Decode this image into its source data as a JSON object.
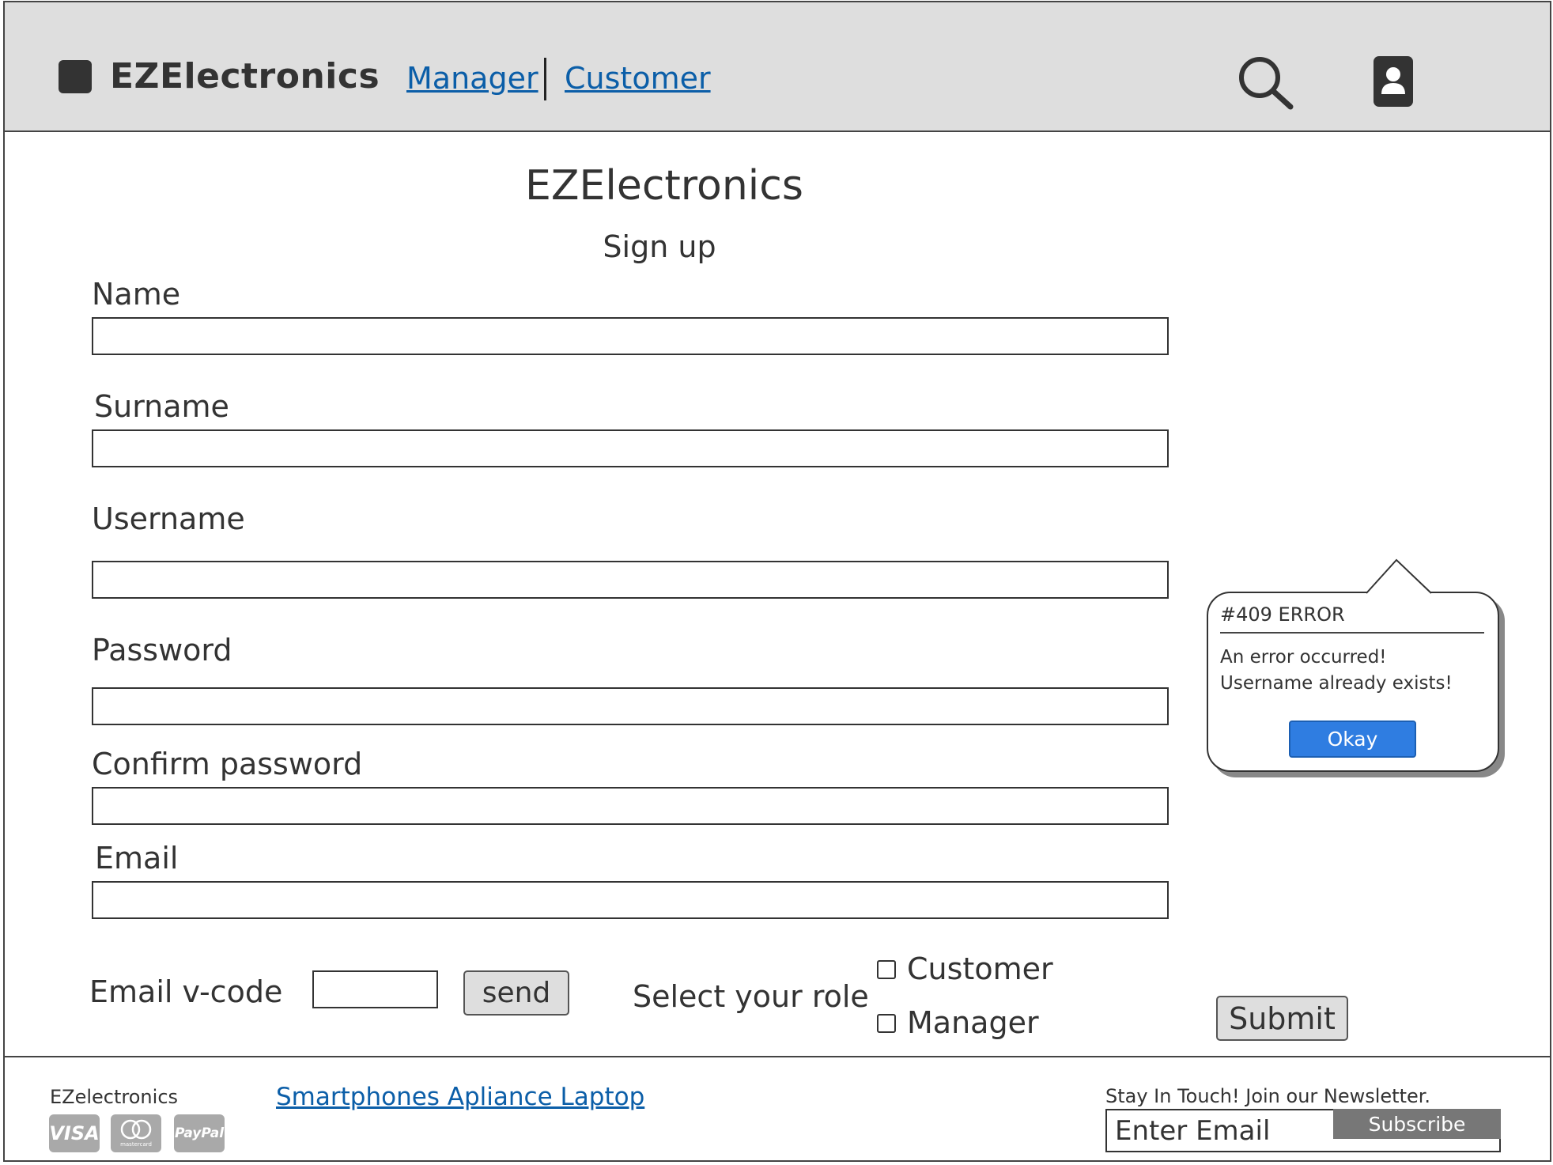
{
  "colors": {
    "header_bg": "#dedede",
    "link": "#0b5ea8",
    "text": "#333333",
    "okay_button": "#2f7de1",
    "subscribe_button": "#777777",
    "payment_badge": "#a9a9a9"
  },
  "header": {
    "logo_icon": "square-logo-icon",
    "brand": "EZElectronics",
    "nav": [
      "Manager",
      "Customer"
    ],
    "search_icon": "search-icon",
    "user_icon": "user-profile-icon"
  },
  "form": {
    "title": "EZElectronics",
    "subtitle": "Sign up",
    "fields": {
      "name_label": "Name",
      "name_value": "",
      "surname_label": "Surname",
      "surname_value": "",
      "username_label": "Username",
      "username_value": "",
      "password_label": "Password",
      "password_value": "",
      "confirm_password_label": "Confirm password",
      "confirm_password_value": "",
      "email_label": "Email",
      "email_value": ""
    },
    "email_vcode_label": "Email v-code",
    "email_vcode_value": "",
    "send_label": "send",
    "role_label": "Select your role",
    "roles": [
      {
        "label": "Customer",
        "checked": false
      },
      {
        "label": "Manager",
        "checked": false
      }
    ],
    "submit_label": "Submit"
  },
  "error_popup": {
    "title": "#409 ERROR",
    "line1": "An error occurred!",
    "line2": "Username already exists!",
    "okay_label": "Okay"
  },
  "footer": {
    "brand": "EZelectronics",
    "links": "Smartphones Apliance Laptop",
    "payment_methods": [
      "VISA",
      "mastercard",
      "PayPal"
    ],
    "newsletter_label": "Stay In Touch! Join our Newsletter.",
    "newsletter_placeholder": "Enter Email",
    "subscribe_label": "Subscribe"
  }
}
